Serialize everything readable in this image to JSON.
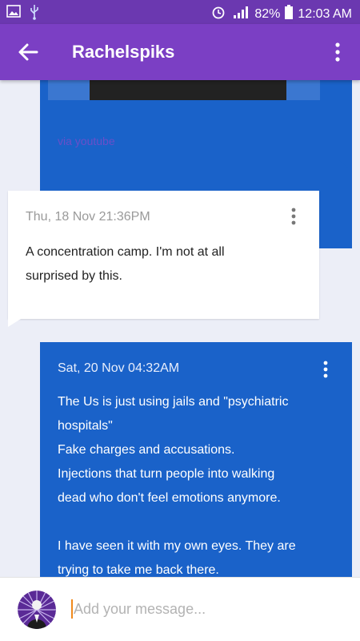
{
  "status_bar": {
    "battery": "82%",
    "time": "12:03 AM",
    "network": "LTE"
  },
  "header": {
    "title": "Rachelspiks"
  },
  "messages": [
    {
      "direction": "outgoing",
      "link_text": "via youtube"
    },
    {
      "direction": "incoming",
      "time": "Thu, 18 Nov 21:36PM",
      "lines": [
        "A concentration camp. I'm not at all",
        "surprised by this."
      ]
    },
    {
      "direction": "outgoing",
      "time": "Sat, 20 Nov 04:32AM",
      "lines": [
        "The Us is just using jails and \"psychiatric",
        "hospitals\"",
        "Fake charges and accusations.",
        "Injections that turn people into walking",
        "dead who don't feel emotions anymore.",
        "",
        "I have seen it with my own eyes. They are",
        "trying to take me back there."
      ]
    }
  ],
  "composer": {
    "placeholder": "Add your message..."
  },
  "colors": {
    "status_bar": "#6b38b0",
    "app_bar": "#7b3fc4",
    "outgoing_bubble": "#1a62c9",
    "incoming_bubble": "#ffffff",
    "background": "#eceef7",
    "cursor": "#f08a1e"
  },
  "icons": [
    "image-icon",
    "usb-icon",
    "alarm-icon",
    "signal-icon",
    "battery-icon",
    "back-arrow-icon",
    "more-vert-icon",
    "avatar-icon"
  ]
}
